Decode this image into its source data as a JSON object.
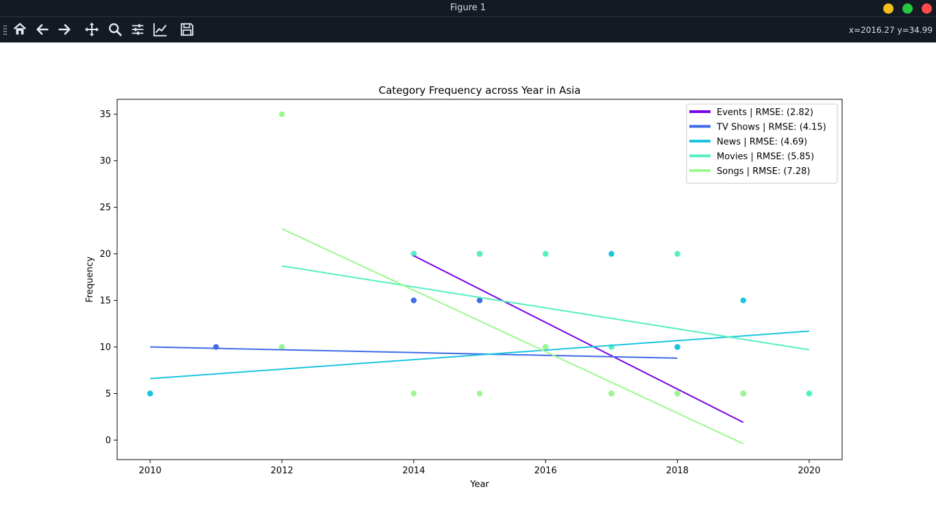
{
  "window": {
    "title": "Figure 1",
    "controls": [
      {
        "name": "minimize",
        "color": "#f5bf1b"
      },
      {
        "name": "maximize",
        "color": "#27c93f"
      },
      {
        "name": "close",
        "color": "#ff4a4a"
      }
    ]
  },
  "toolbar": {
    "buttons": [
      {
        "name": "home-icon",
        "label": "Home"
      },
      {
        "name": "back-icon",
        "label": "Back"
      },
      {
        "name": "forward-icon",
        "label": "Forward"
      },
      {
        "name": "pan-icon",
        "label": "Pan"
      },
      {
        "name": "zoom-icon",
        "label": "Zoom"
      },
      {
        "name": "configure-subplots-icon",
        "label": "Subplots"
      },
      {
        "name": "edit-axis-icon",
        "label": "Customize"
      },
      {
        "name": "save-icon",
        "label": "Save"
      }
    ],
    "coordinates": "x=2016.27 y=34.99"
  },
  "chart_data": {
    "type": "scatter",
    "title": "Category Frequency across Year in Asia",
    "xlabel": "Year",
    "ylabel": "Frequency",
    "xlim": [
      2009.5,
      2020.5
    ],
    "ylim": [
      -2.1,
      36.6
    ],
    "xticks": [
      2010,
      2012,
      2014,
      2016,
      2018,
      2020
    ],
    "yticks": [
      0,
      5,
      10,
      15,
      20,
      25,
      30,
      35
    ],
    "legend_position": "upper right",
    "grid": false,
    "series": [
      {
        "name": "Events | RMSE: (2.82)",
        "color": "#7a00e6",
        "points": [
          [
            2014,
            20
          ],
          [
            2015,
            20
          ],
          [
            2016,
            10
          ],
          [
            2017,
            5
          ],
          [
            2018,
            5
          ],
          [
            2019,
            5
          ]
        ],
        "trend": [
          [
            2014,
            19.8
          ],
          [
            2019,
            1.9
          ]
        ]
      },
      {
        "name": "TV Shows | RMSE: (4.15)",
        "color": "#3f6ae8",
        "points": [
          [
            2010,
            5
          ],
          [
            2011,
            10
          ],
          [
            2014,
            15
          ],
          [
            2015,
            15
          ],
          [
            2018,
            10
          ]
        ],
        "trend": [
          [
            2010,
            10.0
          ],
          [
            2018,
            8.8
          ]
        ]
      },
      {
        "name": "News | RMSE: (4.69)",
        "color": "#1ac4df",
        "points": [
          [
            2010,
            5
          ],
          [
            2017,
            20
          ],
          [
            2018,
            10
          ],
          [
            2019,
            15
          ],
          [
            2020,
            5
          ]
        ],
        "trend": [
          [
            2010,
            6.6
          ],
          [
            2020,
            11.7
          ]
        ]
      },
      {
        "name": "Movies | RMSE: (5.85)",
        "color": "#52f0c0",
        "points": [
          [
            2012,
            10
          ],
          [
            2014,
            20
          ],
          [
            2015,
            20
          ],
          [
            2016,
            20
          ],
          [
            2016,
            10
          ],
          [
            2017,
            10
          ],
          [
            2017,
            5
          ],
          [
            2018,
            20
          ],
          [
            2019,
            5
          ],
          [
            2020,
            5
          ]
        ],
        "trend": [
          [
            2012,
            18.7
          ],
          [
            2020,
            9.7
          ]
        ]
      },
      {
        "name": "Songs | RMSE: (7.28)",
        "color": "#9cf78f",
        "points": [
          [
            2012,
            35
          ],
          [
            2012,
            10
          ],
          [
            2014,
            5
          ],
          [
            2015,
            5
          ],
          [
            2016,
            10
          ],
          [
            2017,
            5
          ],
          [
            2018,
            5
          ],
          [
            2019,
            5
          ]
        ],
        "trend": [
          [
            2012,
            22.7
          ],
          [
            2019,
            -0.4
          ]
        ]
      }
    ]
  }
}
